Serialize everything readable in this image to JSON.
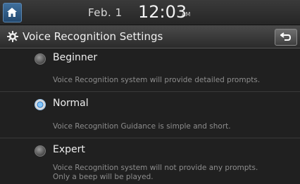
{
  "status": {
    "date": "Feb. 1",
    "time": "12:03",
    "ampm": "AM"
  },
  "header": {
    "title": "Voice Recognition Settings"
  },
  "options": [
    {
      "label": "Beginner",
      "description": "Voice Recognition system will provide detailed prompts.",
      "selected": false
    },
    {
      "label": "Normal",
      "description": "Voice Recognition Guidance is simple and short.",
      "selected": true
    },
    {
      "label": "Expert",
      "description_line1": "Voice Recognition system will not provide any prompts.",
      "description_line2": "Only a beep will be played.",
      "selected": false
    }
  ],
  "icons": {
    "home": "home-icon",
    "settings": "gear-icon",
    "back": "back-arrow-icon"
  },
  "colors": {
    "accent": "#3f6f9c",
    "background": "#202020"
  }
}
